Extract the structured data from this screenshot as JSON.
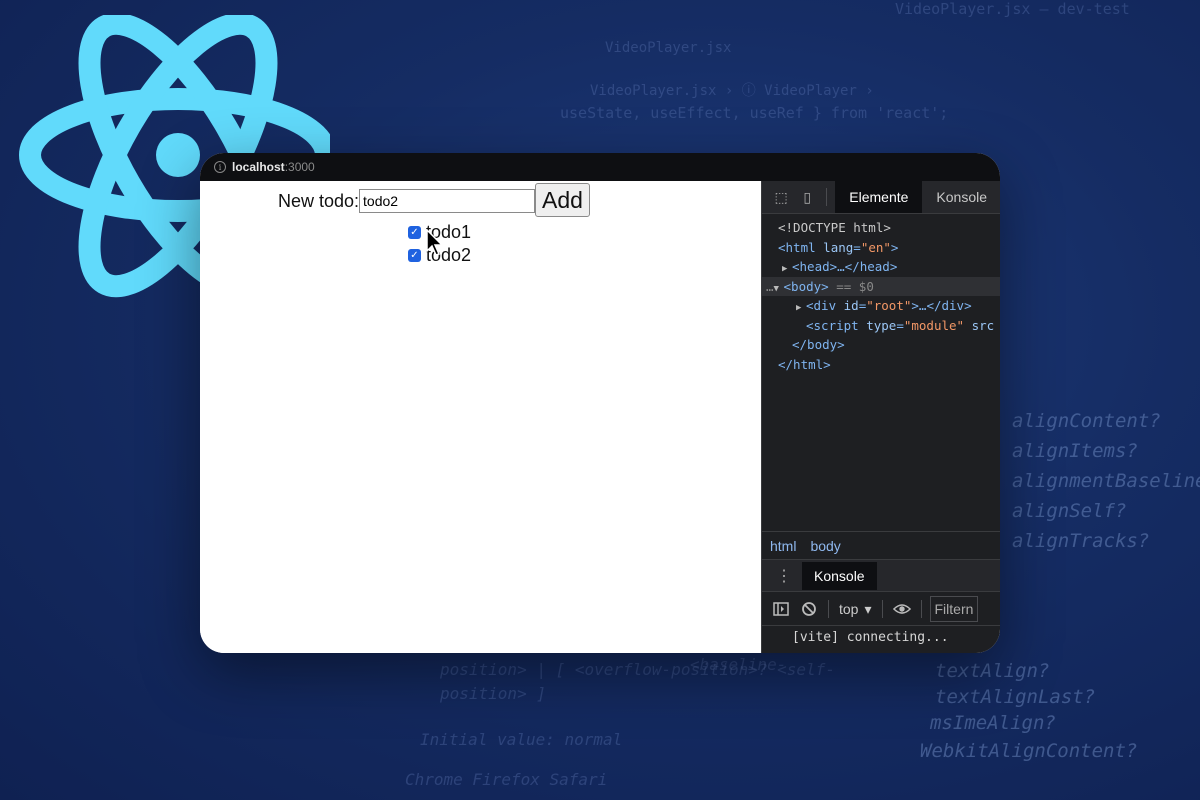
{
  "background": {
    "editor_title": "VideoPlayer.jsx — dev-test",
    "tab_name": "VideoPlayer.jsx",
    "breadcrumb": "VideoPlayer.jsx › ⓘ VideoPlayer › ",
    "import_line": "useState, useEffect, useRef } from 'react';",
    "completions": [
      "alignContent?",
      "alignItems?",
      "alignmentBaseline?",
      "alignSelf?",
      "alignTracks?",
      "textAlign?",
      "textAlignLast?",
      "msImeAlign?",
      "WebkitAlignContent?"
    ],
    "css_snippet_1": "position> | [ <overflow-position>? <self-",
    "css_snippet_2": "position> ]",
    "css_snippet_3": "<baseline-",
    "initial_value": "Initial value: normal",
    "browsers": "Chrome Firefox Safari"
  },
  "browser": {
    "host": "localhost",
    "port": ":3000"
  },
  "app": {
    "label": "New todo:",
    "input_value": "todo2",
    "add_button": "Add",
    "todos": [
      {
        "text": "todo1",
        "checked": true
      },
      {
        "text": "todo2",
        "checked": true
      }
    ]
  },
  "devtools": {
    "tabs": [
      "Elemente",
      "Konsole"
    ],
    "active_tab": "Elemente",
    "dom": {
      "doctype": "<!DOCTYPE html>",
      "html_open": "<html",
      "lang_attr": "lang",
      "lang_val": "\"en\"",
      "head": "<head>…</head>",
      "body_open": "<body>",
      "body_ref": "== $0",
      "div_open": "<div",
      "div_attr": "id",
      "div_val": "\"root\"",
      "div_close": ">…</div>",
      "script_open": "<script",
      "script_attr": "type",
      "script_val": "\"module\"",
      "script_rest": "src",
      "body_close": "</body>",
      "html_close": "</html>"
    },
    "breadcrumbs": [
      "html",
      "body"
    ],
    "drawer_tab": "Konsole",
    "context": "top",
    "filter_placeholder": "Filtern",
    "console_message": "[vite] connecting..."
  },
  "colors": {
    "background": "#152c63",
    "react_logo": "#61dafb",
    "checkbox": "#1f62e0"
  }
}
